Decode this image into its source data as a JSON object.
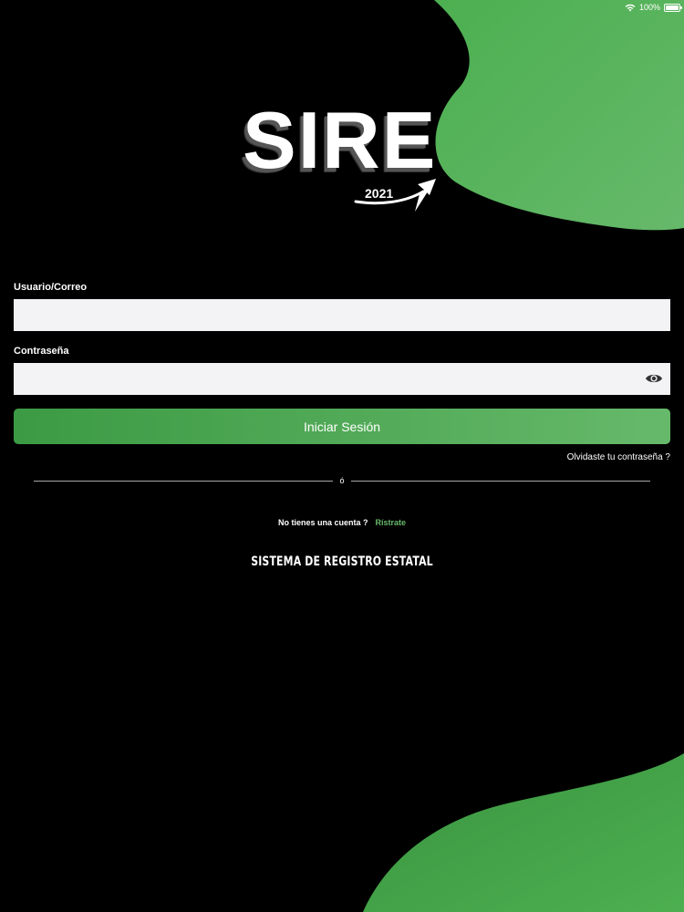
{
  "status_bar": {
    "battery_text": "100%",
    "wifi_icon": "wifi-icon",
    "battery_icon": "battery-icon"
  },
  "logo": {
    "title": "SIRE",
    "year": "2021"
  },
  "form": {
    "username_label": "Usuario/Correo",
    "username_value": "",
    "password_label": "Contraseña",
    "password_value": "",
    "show_password_icon": "eye-icon",
    "login_button": "Iniciar Sesión",
    "forgot_password": "Olvidaste tu contraseña ?"
  },
  "divider": {
    "text": "ó"
  },
  "signup": {
    "prompt": "No tienes una cuenta ?",
    "link": "Rístrate"
  },
  "footer": {
    "title": "SISTEMA DE REGISTRO ESTATAL"
  },
  "colors": {
    "background": "#000000",
    "accent_green": "#4caf50",
    "accent_green_light": "#66b96a",
    "input_background": "#f3f3f6"
  }
}
